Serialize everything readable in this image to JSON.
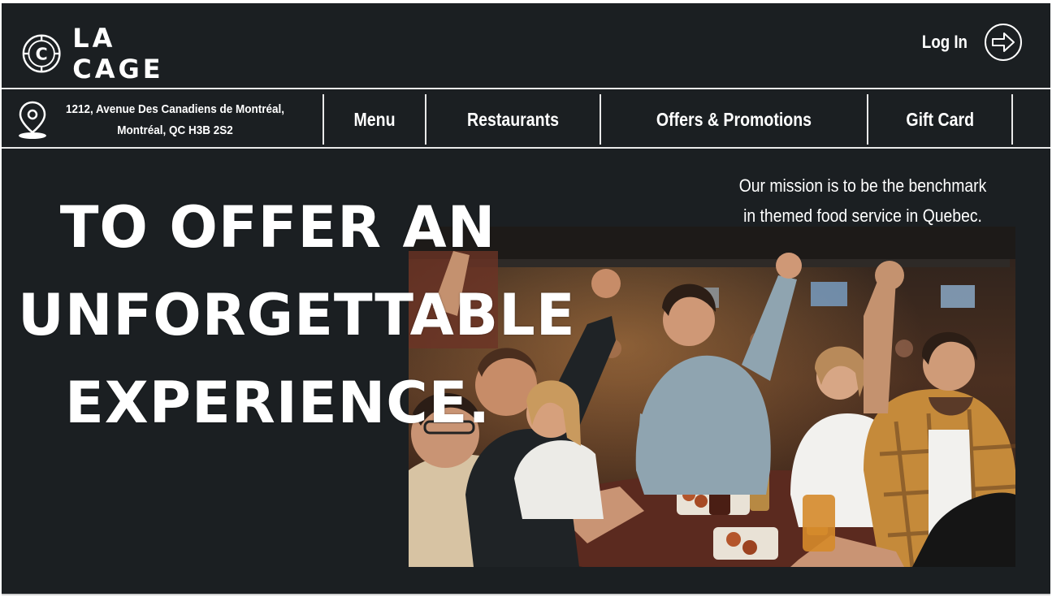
{
  "brand": {
    "name": "LA CAGE",
    "logo_letter": "C"
  },
  "header": {
    "login_label": "Log In",
    "login_icon": "arrow-right-circle-icon"
  },
  "address": {
    "icon": "map-pin-icon",
    "line1": "1212, Avenue Des Canadiens de Montréal,",
    "line2": "Montréal, QC H3B 2S2"
  },
  "nav": {
    "menu": "Menu",
    "restaurants": "Restaurants",
    "offers": "Offers & Promotions",
    "gift_card": "Gift Card"
  },
  "hero": {
    "headline_line1": "TO OFFER AN",
    "headline_line2": "UNFORGETTABLE",
    "headline_line3": "EXPERIENCE.",
    "mission_line1": "Our mission is to be the benchmark",
    "mission_line2": "in themed food service in Quebec."
  },
  "colors": {
    "background": "#1b1f22",
    "text": "#ffffff",
    "lines": "#e9e9e9"
  }
}
